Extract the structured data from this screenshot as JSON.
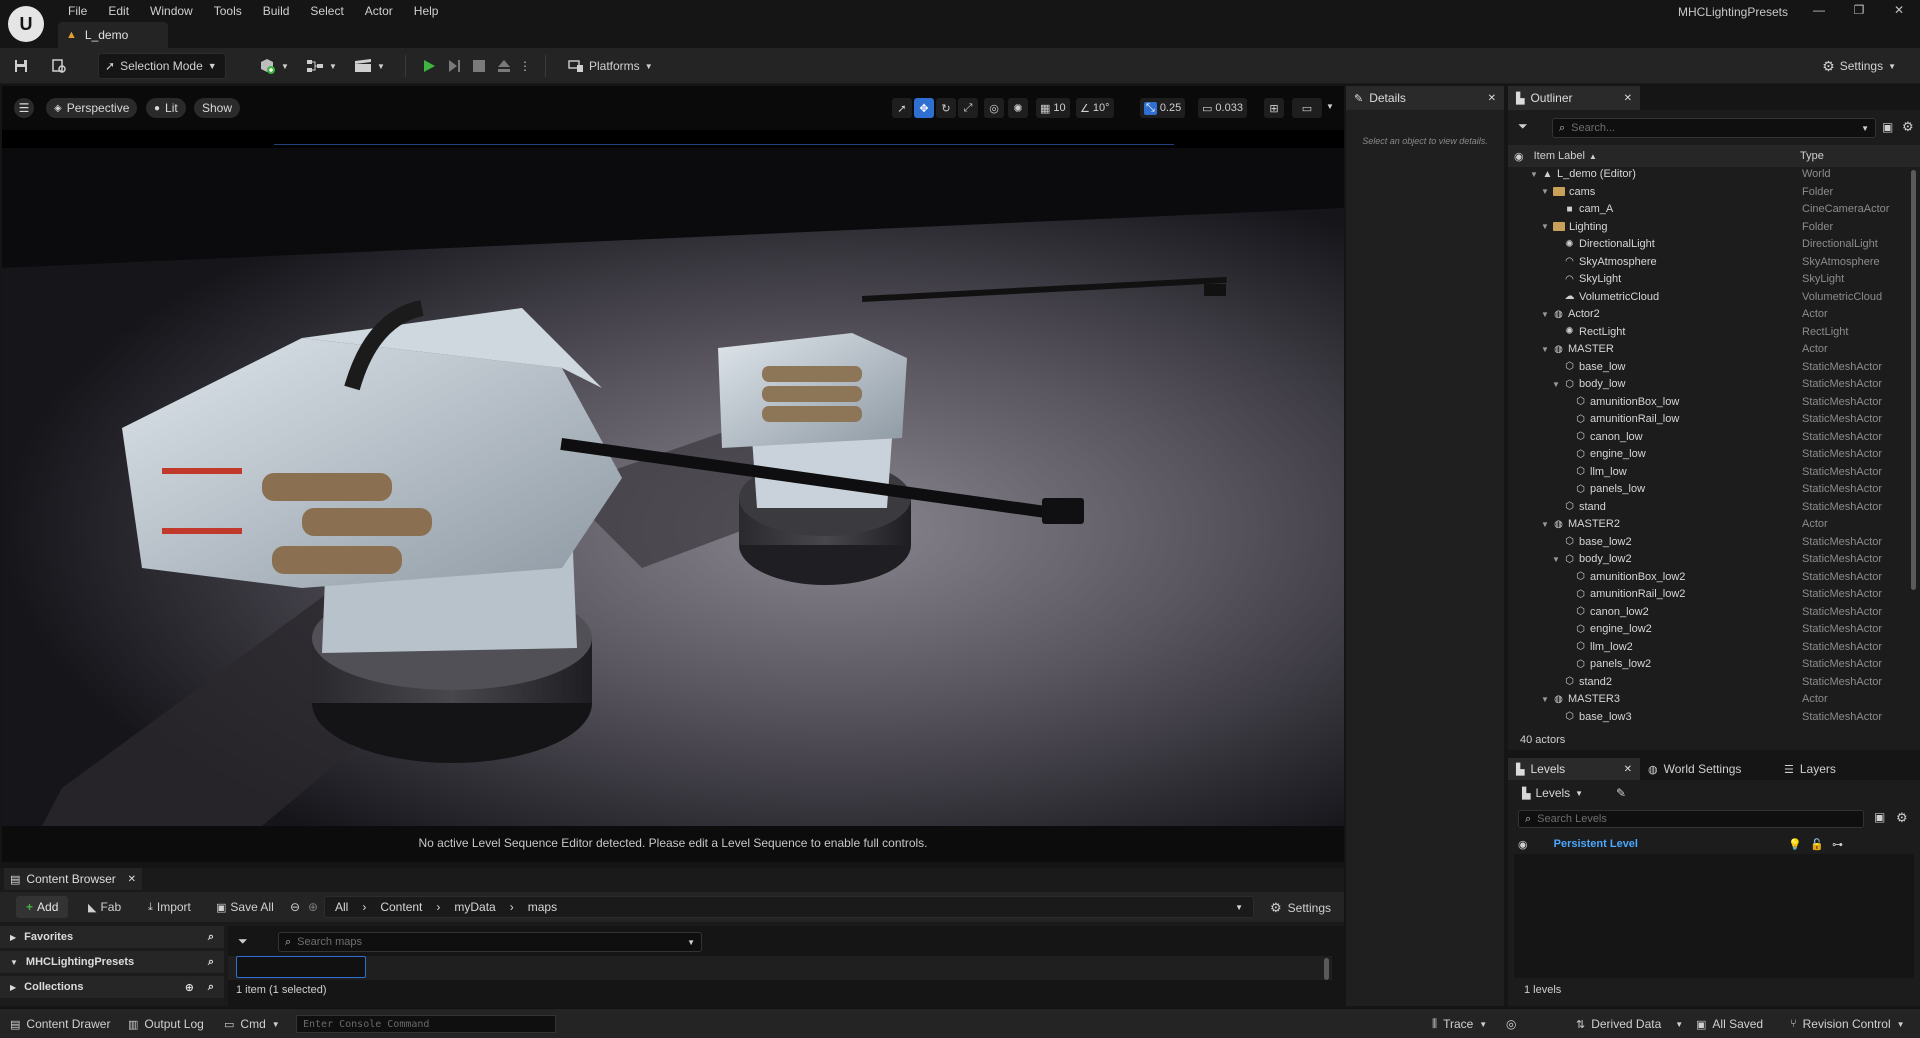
{
  "menu": [
    "File",
    "Edit",
    "Window",
    "Tools",
    "Build",
    "Select",
    "Actor",
    "Help"
  ],
  "level_tab": "L_demo",
  "app_name": "MHCLightingPresets",
  "logo_text": "U",
  "toolbar": {
    "selection_mode": "Selection Mode",
    "platforms": "Platforms",
    "settings": "Settings"
  },
  "viewport": {
    "perspective": "Perspective",
    "lit": "Lit",
    "show": "Show",
    "grid_snap": "10",
    "rot_snap": "10°",
    "scale_snap": "0.25",
    "cam_speed": "0.033",
    "message": "No active Level Sequence Editor detected. Please edit a Level Sequence to enable full controls."
  },
  "details": {
    "tab": "Details",
    "hint": "Select an object to view details."
  },
  "outliner": {
    "tab": "Outliner",
    "search_placeholder": "Search...",
    "col_label": "Item Label",
    "col_type": "Type",
    "footer": "40 actors",
    "rows": [
      {
        "label": "L_demo (Editor)",
        "type": "World",
        "depth": 0,
        "exp": "open",
        "icon": "world"
      },
      {
        "label": "cams",
        "type": "Folder",
        "depth": 1,
        "exp": "open",
        "icon": "folder"
      },
      {
        "label": "cam_A",
        "type": "CineCameraActor",
        "depth": 2,
        "exp": "none",
        "icon": "camera"
      },
      {
        "label": "Lighting",
        "type": "Folder",
        "depth": 1,
        "exp": "open",
        "icon": "folder"
      },
      {
        "label": "DirectionalLight",
        "type": "DirectionalLight",
        "depth": 2,
        "exp": "none",
        "icon": "sun"
      },
      {
        "label": "SkyAtmosphere",
        "type": "SkyAtmosphere",
        "depth": 2,
        "exp": "none",
        "icon": "sky"
      },
      {
        "label": "SkyLight",
        "type": "SkyLight",
        "depth": 2,
        "exp": "none",
        "icon": "sky"
      },
      {
        "label": "VolumetricCloud",
        "type": "VolumetricCloud",
        "depth": 2,
        "exp": "none",
        "icon": "cloud"
      },
      {
        "label": "Actor2",
        "type": "Actor",
        "depth": 1,
        "exp": "open",
        "icon": "actor"
      },
      {
        "label": "RectLight",
        "type": "RectLight",
        "depth": 2,
        "exp": "none",
        "icon": "sun"
      },
      {
        "label": "MASTER",
        "type": "Actor",
        "depth": 1,
        "exp": "open",
        "icon": "actor"
      },
      {
        "label": "base_low",
        "type": "StaticMeshActor",
        "depth": 2,
        "exp": "none",
        "icon": "mesh"
      },
      {
        "label": "body_low",
        "type": "StaticMeshActor",
        "depth": 2,
        "exp": "open",
        "icon": "mesh"
      },
      {
        "label": "amunitionBox_low",
        "type": "StaticMeshActor",
        "depth": 3,
        "exp": "none",
        "icon": "mesh"
      },
      {
        "label": "amunitionRail_low",
        "type": "StaticMeshActor",
        "depth": 3,
        "exp": "none",
        "icon": "mesh"
      },
      {
        "label": "canon_low",
        "type": "StaticMeshActor",
        "depth": 3,
        "exp": "none",
        "icon": "mesh"
      },
      {
        "label": "engine_low",
        "type": "StaticMeshActor",
        "depth": 3,
        "exp": "none",
        "icon": "mesh"
      },
      {
        "label": "llm_low",
        "type": "StaticMeshActor",
        "depth": 3,
        "exp": "none",
        "icon": "mesh"
      },
      {
        "label": "panels_low",
        "type": "StaticMeshActor",
        "depth": 3,
        "exp": "none",
        "icon": "mesh"
      },
      {
        "label": "stand",
        "type": "StaticMeshActor",
        "depth": 2,
        "exp": "none",
        "icon": "mesh"
      },
      {
        "label": "MASTER2",
        "type": "Actor",
        "depth": 1,
        "exp": "open",
        "icon": "actor"
      },
      {
        "label": "base_low2",
        "type": "StaticMeshActor",
        "depth": 2,
        "exp": "none",
        "icon": "mesh"
      },
      {
        "label": "body_low2",
        "type": "StaticMeshActor",
        "depth": 2,
        "exp": "open",
        "icon": "mesh"
      },
      {
        "label": "amunitionBox_low2",
        "type": "StaticMeshActor",
        "depth": 3,
        "exp": "none",
        "icon": "mesh"
      },
      {
        "label": "amunitionRail_low2",
        "type": "StaticMeshActor",
        "depth": 3,
        "exp": "none",
        "icon": "mesh"
      },
      {
        "label": "canon_low2",
        "type": "StaticMeshActor",
        "depth": 3,
        "exp": "none",
        "icon": "mesh"
      },
      {
        "label": "engine_low2",
        "type": "StaticMeshActor",
        "depth": 3,
        "exp": "none",
        "icon": "mesh"
      },
      {
        "label": "llm_low2",
        "type": "StaticMeshActor",
        "depth": 3,
        "exp": "none",
        "icon": "mesh"
      },
      {
        "label": "panels_low2",
        "type": "StaticMeshActor",
        "depth": 3,
        "exp": "none",
        "icon": "mesh"
      },
      {
        "label": "stand2",
        "type": "StaticMeshActor",
        "depth": 2,
        "exp": "none",
        "icon": "mesh"
      },
      {
        "label": "MASTER3",
        "type": "Actor",
        "depth": 1,
        "exp": "open",
        "icon": "actor"
      },
      {
        "label": "base_low3",
        "type": "StaticMeshActor",
        "depth": 2,
        "exp": "none",
        "icon": "mesh"
      }
    ]
  },
  "levels": {
    "tab_levels": "Levels",
    "tab_world_settings": "World Settings",
    "tab_layers": "Layers",
    "dropdown": "Levels",
    "search_placeholder": "Search Levels",
    "persistent_level": "Persistent Level",
    "footer": "1 levels"
  },
  "content_browser": {
    "tab": "Content Browser",
    "add": "Add",
    "fab": "Fab",
    "import": "Import",
    "save_all": "Save All",
    "path": [
      "All",
      "Content",
      "myData",
      "maps"
    ],
    "settings": "Settings",
    "favorites": "Favorites",
    "project": "MHCLightingPresets",
    "collections": "Collections",
    "search_placeholder": "Search maps",
    "status": "1 item (1 selected)"
  },
  "statusbar": {
    "content_drawer": "Content Drawer",
    "output_log": "Output Log",
    "cmd": "Cmd",
    "console_placeholder": "Enter Console Command",
    "trace": "Trace",
    "derived_data": "Derived Data",
    "all_saved": "All Saved",
    "revision_control": "Revision Control"
  },
  "colors": {
    "accent_blue": "#2f6fd1",
    "persistent_level": "#4aa8ff",
    "play_green": "#3fb33f",
    "folder": "#c9a05a"
  }
}
